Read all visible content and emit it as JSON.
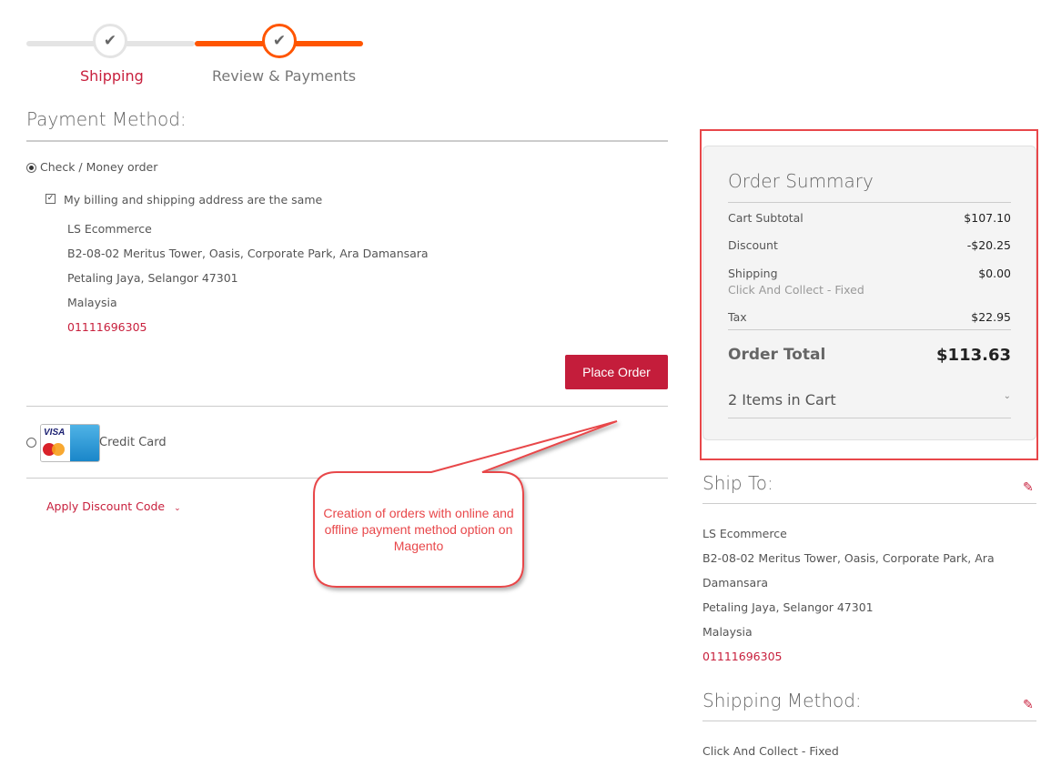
{
  "progress": {
    "steps": [
      {
        "label": "Shipping",
        "state": "complete"
      },
      {
        "label": "Review & Payments",
        "state": "active"
      }
    ]
  },
  "payment": {
    "title": "Payment Method:",
    "methods": [
      {
        "label": "Check / Money order",
        "selected": true
      },
      {
        "label": "Credit Card",
        "selected": false
      }
    ],
    "same_address_label": "My billing and shipping address are the same",
    "same_address_checked": true,
    "address": {
      "name": "LS Ecommerce",
      "street": "B2-08-02 Meritus Tower, Oasis, Corporate Park, Ara Damansara",
      "city": "Petaling Jaya, Selangor 47301",
      "country": "Malaysia",
      "phone": "01111696305"
    },
    "place_order": "Place Order",
    "discount": "Apply Discount Code"
  },
  "summary": {
    "title": "Order Summary",
    "rows": [
      {
        "label": "Cart Subtotal",
        "value": "$107.10"
      },
      {
        "label": "Discount",
        "value": "-$20.25"
      },
      {
        "label": "Shipping",
        "sub": "Click And Collect - Fixed",
        "value": "$0.00"
      },
      {
        "label": "Tax",
        "value": "$22.95"
      }
    ],
    "total_label": "Order Total",
    "total_value": "$113.63",
    "items": "2 Items in Cart"
  },
  "ship_to": {
    "title": "Ship To:",
    "lines": [
      "LS Ecommerce",
      "B2-08-02 Meritus Tower, Oasis, Corporate Park, Ara",
      "Damansara",
      "Petaling Jaya, Selangor 47301",
      "Malaysia"
    ],
    "phone": "01111696305"
  },
  "shipping_method": {
    "title": "Shipping Method:",
    "value": "Click And Collect - Fixed"
  },
  "callout": {
    "text": "Creation of orders with online and offline payment method option on Magento"
  },
  "colors": {
    "accent": "#ff5501",
    "brand": "#c41d3b",
    "highlight": "#e8474a"
  }
}
